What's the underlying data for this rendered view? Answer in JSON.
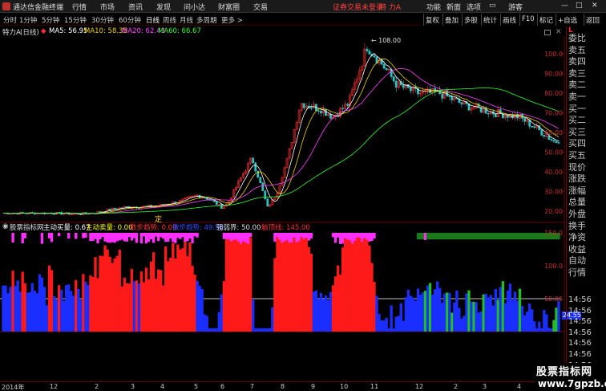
{
  "titlebar": {
    "app_title": "通达信金融终端",
    "menus": [
      "行情",
      "市场",
      "资讯",
      "发现",
      "问小达",
      "财富圈",
      "交易"
    ],
    "notice": "证券交易未登录",
    "stock_name": "特 力A",
    "right_menus": [
      "功能",
      "新面",
      "选项",
      "游客"
    ]
  },
  "periods": {
    "items": [
      "分时",
      "1分钟",
      "5分钟",
      "15分钟",
      "30分钟",
      "60分钟",
      "日线",
      "周线",
      "月线",
      "多周期",
      "更多 >"
    ],
    "active": "日线"
  },
  "right_toolbar": [
    "复权",
    "叠加",
    "多股",
    "统计",
    "画线",
    "F10",
    "标记",
    "+自选",
    "返回"
  ],
  "info": {
    "stock": "特力A",
    "period_label": "(日线)",
    "ma5": "MA5: 56.95",
    "ma10": "MA10: 58.35",
    "ma20": "MA20: 62.43",
    "ma60": "MA60: 66.67"
  },
  "indicator": {
    "name": "股票指标网",
    "v1": "主动买量: 0.67",
    "v2": "主动卖量: 0.00",
    "v3": "散步趋势: 0.00",
    "v4": "散步趋势: 49.58",
    "v5": "强弱界: 50.00",
    "v6": "触顶线: 145.00",
    "marker": "定",
    "value_box": "24.55"
  },
  "price_axis": [
    "100.0",
    "90.00",
    "80.00",
    "70.00",
    "60.00",
    "50.00",
    "40.00",
    "30.00",
    "20.00"
  ],
  "ind_axis": [
    "150.0",
    "100.0",
    "50.00"
  ],
  "peak_label": "108.00",
  "right_panel": {
    "title": "L",
    "labels": [
      "委比",
      "卖五",
      "卖四",
      "卖三",
      "卖二",
      "卖一",
      "买一",
      "买二",
      "买三",
      "买四",
      "买五",
      "现价",
      "涨跌",
      "涨幅",
      "总量",
      "外盘",
      "换手",
      "净资",
      "收益",
      "自动",
      "行情"
    ],
    "times": [
      "14:56",
      "14:56",
      "14:56",
      "14:56",
      "14:56",
      "14:56",
      "14:56",
      "14:56"
    ]
  },
  "dates": [
    "2014年",
    "12",
    "2",
    "3",
    "4",
    "5",
    "6",
    "7",
    "8",
    "9",
    "10",
    "11",
    "12",
    "2",
    "3",
    "4"
  ],
  "watermark": {
    "line1": "股票指标网",
    "line2": "www.7gpzb.com"
  },
  "colors": {
    "up": "#ff3030",
    "down": "#30c0c0",
    "ma5": "#ffffff",
    "ma10": "#f0d000",
    "ma20": "#ff40ff",
    "ma60": "#30ff30",
    "red_fill": "#ff1a1a",
    "blue_fill": "#1a2fff",
    "magenta_fill": "#ff30ff",
    "green_fill": "#20c020"
  }
}
